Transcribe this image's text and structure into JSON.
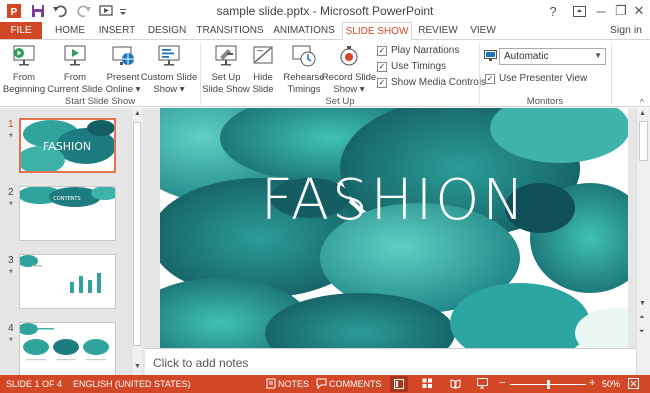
{
  "app": {
    "title": "sample slide.pptx - Microsoft PowerPoint",
    "signin": "Sign in",
    "help": "?",
    "minimize": "─",
    "restore": "❐",
    "close": "✕",
    "icons": [
      "powerpoint-logo-icon",
      "save-icon",
      "undo-icon",
      "redo-icon",
      "start-from-beginning-icon",
      "customize-qat-icon"
    ]
  },
  "tabs": [
    {
      "label": "FILE"
    },
    {
      "label": "HOME"
    },
    {
      "label": "INSERT"
    },
    {
      "label": "DESIGN"
    },
    {
      "label": "TRANSITIONS"
    },
    {
      "label": "ANIMATIONS"
    },
    {
      "label": "SLIDE SHOW",
      "active": true
    },
    {
      "label": "REVIEW"
    },
    {
      "label": "VIEW"
    }
  ],
  "ribbon": {
    "start": {
      "group": "Start Slide Show",
      "from_beginning": [
        "From",
        "Beginning"
      ],
      "from_current": [
        "From",
        "Current Slide"
      ],
      "present_online": [
        "Present",
        "Online ▾"
      ],
      "custom_show": [
        "Custom Slide",
        "Show ▾"
      ]
    },
    "setup": {
      "group": "Set Up",
      "setup_show": [
        "Set Up",
        "Slide Show"
      ],
      "hide_slide": [
        "Hide",
        "Slide"
      ],
      "rehearse": [
        "Rehearse",
        "Timings"
      ],
      "record": [
        "Record Slide",
        "Show ▾"
      ],
      "play_narrations": "Play Narrations",
      "use_timings": "Use Timings",
      "show_media_controls": "Show Media Controls",
      "checks": {
        "play_narrations": true,
        "use_timings": true,
        "show_media_controls": true
      }
    },
    "monitors": {
      "group": "Monitors",
      "monitor_value": "Automatic",
      "use_presenter_view": "Use Presenter View",
      "presenter_checked": true
    },
    "collapse": "^"
  },
  "thumbnails": [
    {
      "number": "1",
      "star": "*",
      "title": "FASHION",
      "selected": true
    },
    {
      "number": "2",
      "star": "*",
      "title": "CONTENTS"
    },
    {
      "number": "3",
      "star": "*",
      "chart_values": [
        0.55,
        0.85,
        0.65,
        1.0
      ]
    },
    {
      "number": "4",
      "star": "*"
    }
  ],
  "slide": {
    "title": "FASHION"
  },
  "notes": {
    "placeholder": "Click to add notes"
  },
  "status": {
    "slide_info": "SLIDE 1 OF 4",
    "language": "ENGLISH (UNITED STATES)",
    "notes": "NOTES",
    "comments": "COMMENTS",
    "zoom_minus": "−",
    "zoom_plus": "+",
    "zoom": "50%",
    "zoom_fraction": 0.5
  },
  "colors": {
    "accent": "#d24726",
    "teal": "#2fa39c",
    "teal_dark": "#135d63"
  }
}
